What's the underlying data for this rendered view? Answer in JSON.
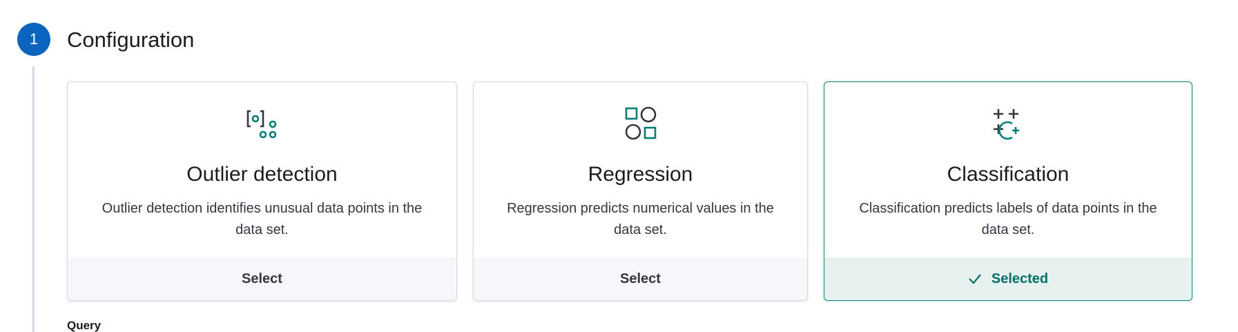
{
  "step": {
    "number": "1",
    "title": "Configuration"
  },
  "cards": [
    {
      "title": "Outlier detection",
      "description": "Outlier detection identifies unusual data points in the data set.",
      "button_label": "Select",
      "icon": "outlier-detection-icon",
      "selected": false
    },
    {
      "title": "Regression",
      "description": "Regression predicts numerical values in the data set.",
      "button_label": "Select",
      "icon": "regression-icon",
      "selected": false
    },
    {
      "title": "Classification",
      "description": "Classification predicts labels of data points in the data set.",
      "button_label": "Selected",
      "icon": "classification-icon",
      "selected": true
    }
  ],
  "query_label": "Query",
  "colors": {
    "step_circle": "#0b64be",
    "accent": "#017d73",
    "icon_dark": "#343741",
    "footer_bg": "#f5f7fa",
    "selected_footer_bg": "#e6f1f0"
  }
}
